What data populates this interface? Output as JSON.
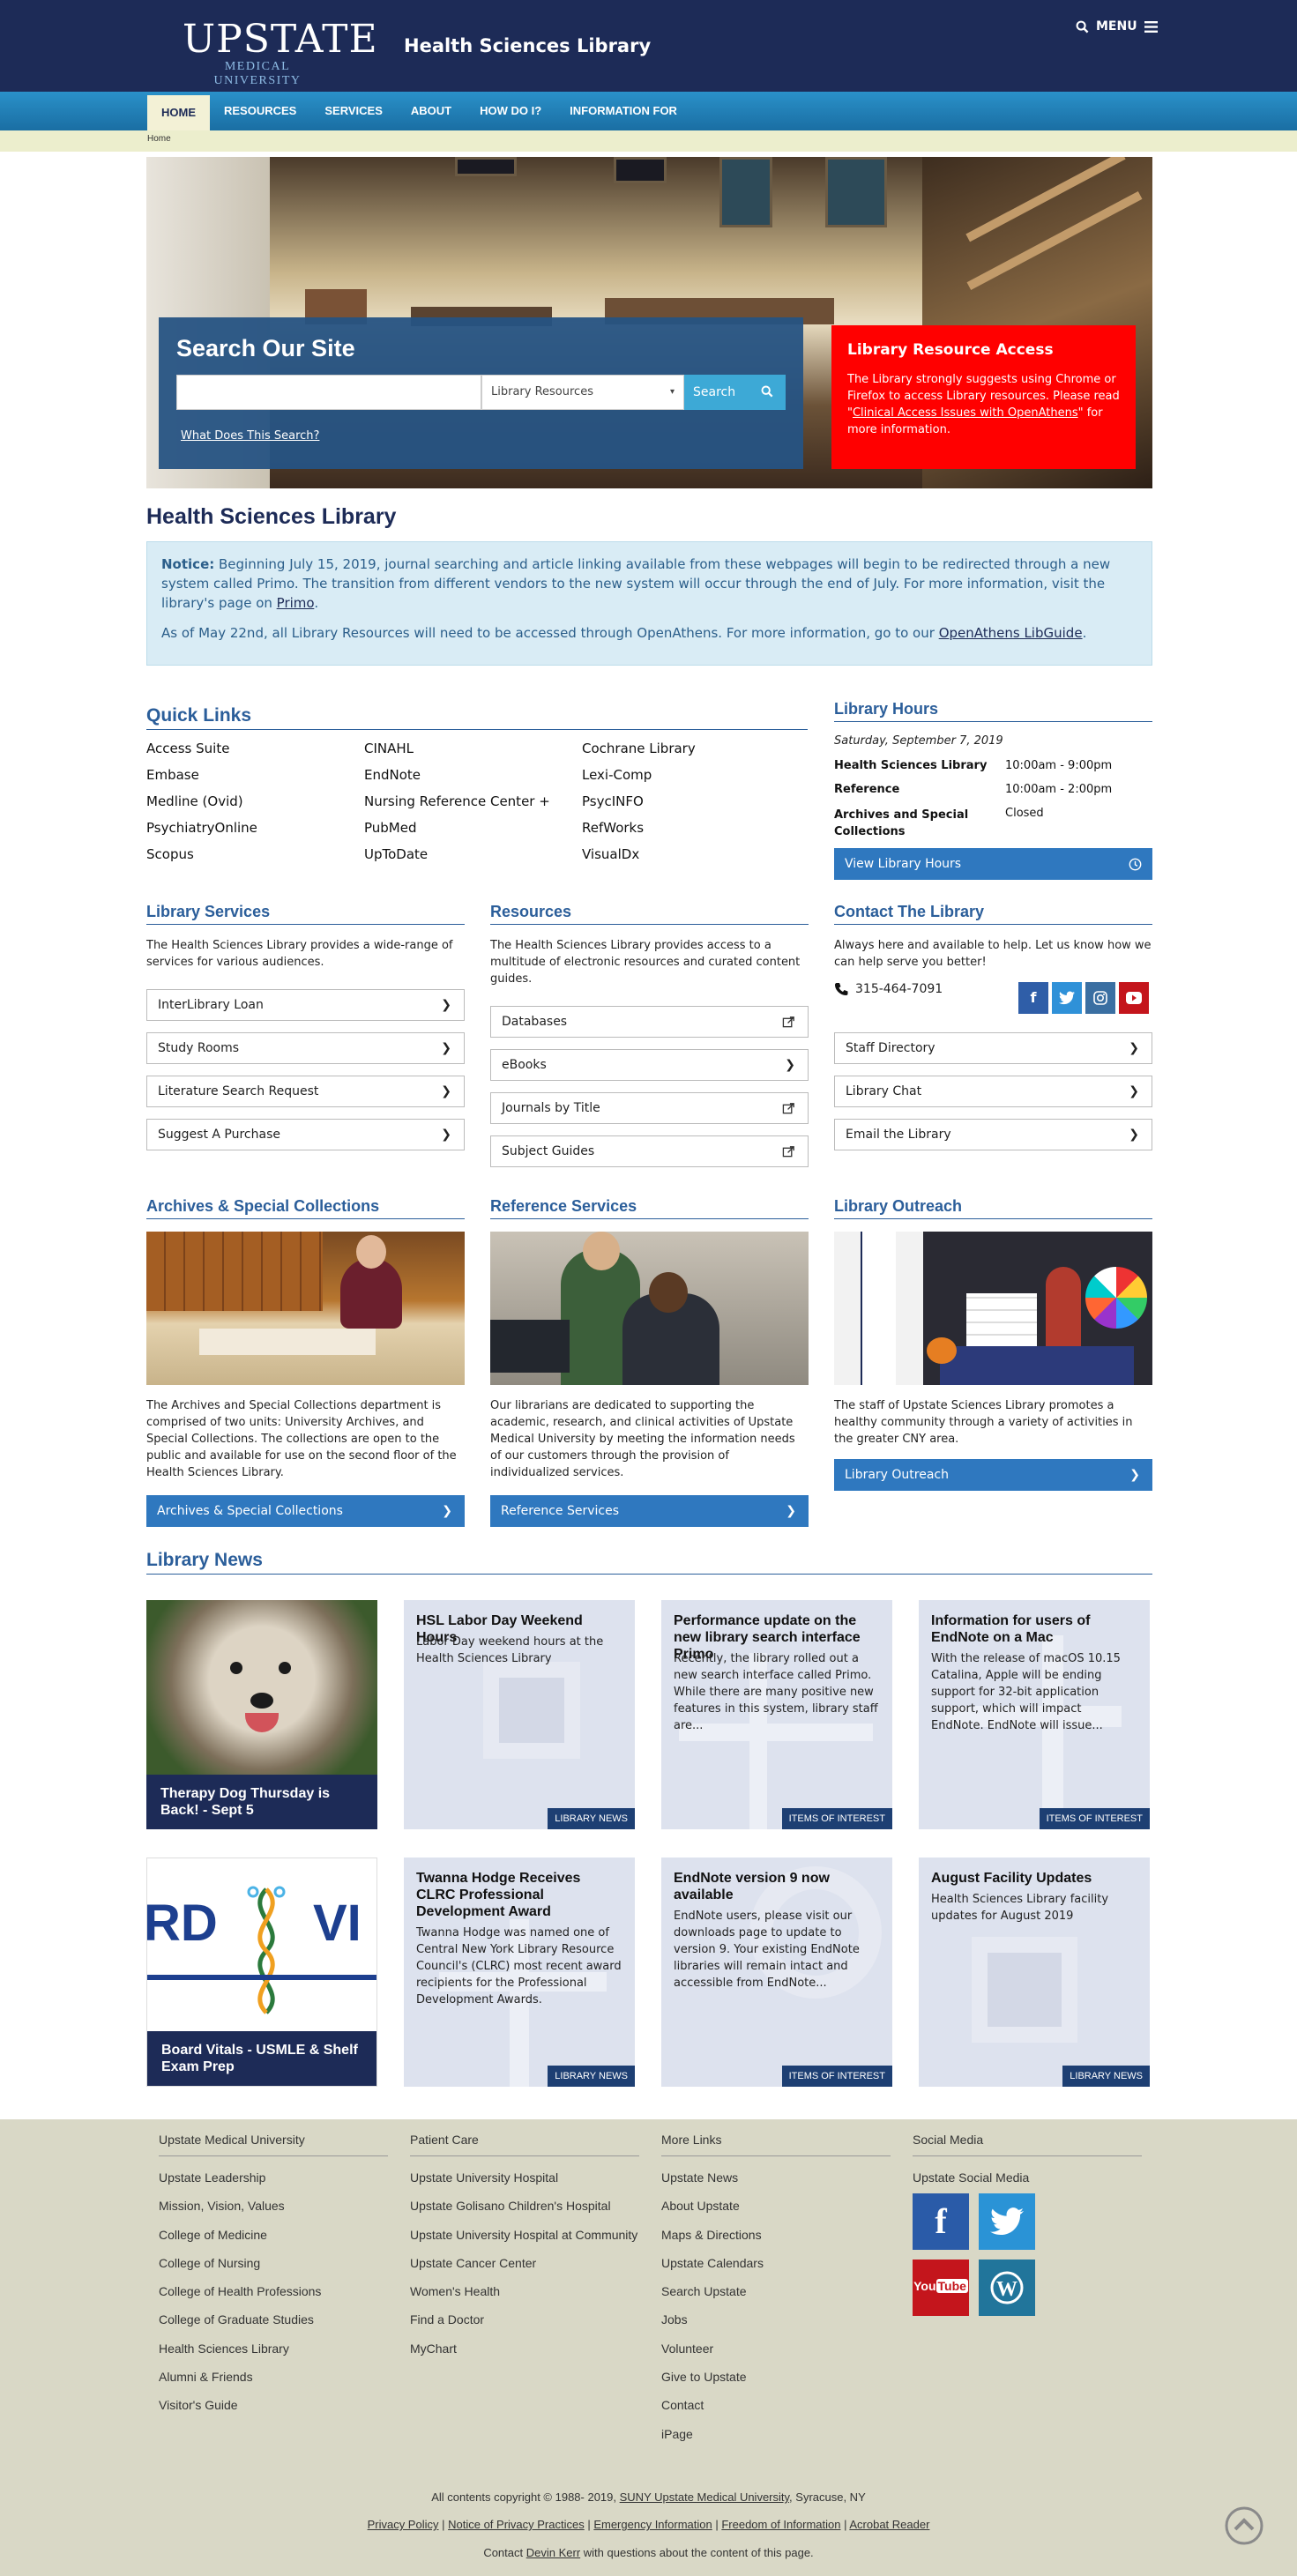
{
  "header": {
    "logo_main": "UPSTATE",
    "logo_sub": "MEDICAL UNIVERSITY",
    "site_name": "Health Sciences Library",
    "menu_label": "MENU"
  },
  "nav": {
    "items": [
      {
        "label": "HOME"
      },
      {
        "label": "RESOURCES"
      },
      {
        "label": "SERVICES"
      },
      {
        "label": "ABOUT"
      },
      {
        "label": "HOW DO I?"
      },
      {
        "label": "INFORMATION FOR"
      }
    ],
    "breadcrumb": "Home"
  },
  "search": {
    "title": "Search Our Site",
    "input_value": "",
    "select_value": "Library Resources",
    "button_label": "Search",
    "help_link": "What Does This Search?"
  },
  "alert": {
    "title": "Library Resource Access",
    "text_before": "The Library strongly suggests using Chrome or Firefox to access Library resources. Please read \"",
    "link": "Clinical Access Issues with OpenAthens",
    "text_after": "\" for more information."
  },
  "page_title": "Health Sciences Library",
  "notice": {
    "label": "Notice:",
    "p1": " Beginning July 15, 2019, journal searching and article linking available from these webpages will begin to be redirected through a new system called Primo. The transition from different vendors to the new system will occur through the end of July. For more information, visit the library's page on ",
    "p1_link": "Primo",
    "p1_end": ".",
    "p2": "As of May 22nd, all Library Resources will need to be accessed through OpenAthens. For more information, go to our ",
    "p2_link": "OpenAthens LibGuide",
    "p2_end": "."
  },
  "quick_links": {
    "title": "Quick Links",
    "col1": [
      "Access Suite",
      "Embase",
      "Medline (Ovid)",
      "PsychiatryOnline",
      "Scopus"
    ],
    "col2": [
      "CINAHL",
      "EndNote",
      "Nursing Reference Center +",
      "PubMed",
      "UpToDate"
    ],
    "col3": [
      "Cochrane Library",
      "Lexi-Comp",
      "PsycINFO",
      "RefWorks",
      "VisualDx"
    ]
  },
  "hours": {
    "title": "Library Hours",
    "date": "Saturday, September 7, 2019",
    "rows": [
      {
        "name": "Health Sciences Library",
        "value": "10:00am - 9:00pm"
      },
      {
        "name": "Reference",
        "value": "10:00am - 2:00pm"
      },
      {
        "name": "Archives and Special Collections",
        "value": "Closed"
      }
    ],
    "button": "View Library Hours"
  },
  "library_services": {
    "title": "Library Services",
    "desc": "The Health Sciences Library provides a wide-range of services for various audiences.",
    "links": [
      "InterLibrary Loan",
      "Study Rooms",
      "Literature Search Request",
      "Suggest A Purchase"
    ]
  },
  "resources": {
    "title": "Resources",
    "desc": "The Health Sciences Library provides access to a multitude of electronic resources and curated content guides.",
    "links": [
      "Databases",
      "eBooks",
      "Journals by Title",
      "Subject Guides"
    ]
  },
  "contact": {
    "title": "Contact The Library",
    "desc": "Always here and available to help. Let us know how we can help serve you better!",
    "phone": "315-464-7091",
    "links": [
      "Staff Directory",
      "Library Chat",
      "Email the Library"
    ]
  },
  "archives": {
    "title": "Archives & Special Collections",
    "desc": "The Archives and Special Collections department is comprised of two units: University Archives, and Special Collections. The collections are open to the public and available for use on the second floor of the Health Sciences Library.",
    "button": "Archives & Special Collections"
  },
  "reference": {
    "title": "Reference Services",
    "desc": "Our librarians are dedicated to supporting the academic, research, and clinical activities of Upstate Medical University by meeting the information needs of our customers through the provision of individualized services.",
    "button": "Reference Services"
  },
  "outreach": {
    "title": "Library Outreach",
    "desc": "The staff of Upstate Sciences Library promotes a healthy community through a variety of activities in the greater CNY area.",
    "button": "Library Outreach"
  },
  "news": {
    "title": "Library News",
    "items": [
      {
        "title": "Therapy Dog Thursday is Back! - Sept 5",
        "desc": "",
        "tag": ""
      },
      {
        "title": "HSL Labor Day Weekend Hours",
        "desc": "Labor Day weekend hours at the Health Sciences Library",
        "tag": "LIBRARY NEWS"
      },
      {
        "title": "Performance update on the new library search interface Primo",
        "desc": "Recently, the library rolled out a new search interface called Primo. While there are many positive new features in this system, library staff are...",
        "tag": "ITEMS OF INTEREST"
      },
      {
        "title": "Information for users of EndNote on a Mac",
        "desc": "With the release of macOS 10.15 Catalina, Apple will be ending support for 32-bit application support, which will impact EndNote. EndNote will issue...",
        "tag": "ITEMS OF INTEREST"
      },
      {
        "title": "Board Vitals - USMLE & Shelf Exam Prep",
        "desc": "",
        "tag": ""
      },
      {
        "title": "Twanna Hodge Receives CLRC Professional Development Award",
        "desc": "Twanna Hodge was named one of Central New York Library Resource Council's (CLRC) most recent award recipients for the Professional Development Awards.",
        "tag": "LIBRARY NEWS"
      },
      {
        "title": "EndNote version 9 now available",
        "desc": "EndNote users, please visit our downloads page to update to version 9. Your existing EndNote libraries will remain intact and accessible from EndNote...",
        "tag": "ITEMS OF INTEREST"
      },
      {
        "title": "August Facility Updates",
        "desc": "Health Sciences Library facility updates for August 2019",
        "tag": "LIBRARY NEWS"
      }
    ],
    "boardvitals_text_left": "RD",
    "boardvitals_text_right": "VI"
  },
  "footer": {
    "col1": [
      "Upstate Medical University",
      "Upstate Leadership",
      "Mission, Vision, Values",
      "College of Medicine",
      "College of Nursing",
      "College of Health Professions",
      "College of Graduate Studies",
      "Health Sciences Library",
      "Alumni & Friends",
      "Visitor's Guide"
    ],
    "col2": [
      "Patient Care",
      "Upstate University Hospital",
      "Upstate Golisano Children's Hospital",
      "Upstate University Hospital at Community",
      "Upstate Cancer Center",
      "Women's Health",
      "Find a Doctor",
      "MyChart"
    ],
    "col3": [
      "More Links",
      "Upstate News",
      "About Upstate",
      "Maps & Directions",
      "Upstate Calendars",
      "Search Upstate",
      "Jobs",
      "Volunteer",
      "Give to Upstate",
      "Contact",
      "iPage"
    ],
    "col4_head": "Social Media",
    "col4_item": "Upstate Social Media",
    "copyright_pre": "All contents copyright © 1988- 2019, ",
    "copyright_link": "SUNY Upstate Medical University",
    "copyright_post": ", Syracuse, NY",
    "policy_links": [
      "Privacy Policy",
      "Notice of Privacy Practices",
      "Emergency Information",
      "Freedom of Information",
      "Acrobat Reader"
    ],
    "contact_pre": "Contact ",
    "contact_link": "Devin Kerr",
    "contact_post": " with questions about the content of this page."
  },
  "colors": {
    "header": "#1d2b57",
    "nav": "#2a91c9",
    "accent": "#2f78bf",
    "alert": "#ff0000"
  }
}
